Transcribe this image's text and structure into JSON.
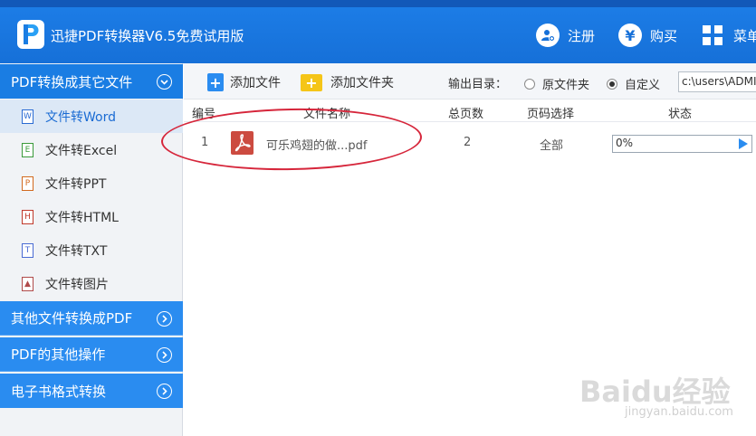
{
  "app": {
    "title": "迅捷PDF转换器V6.5免费试用版"
  },
  "topbar": {
    "register_label": "注册",
    "buy_label": "购买",
    "buy_icon_glyph": "¥",
    "menu_label": "菜单"
  },
  "sidebar": {
    "active_category": "PDF转换成其它文件",
    "sub_items": [
      {
        "label": "文件转Word",
        "icon": "word-file-icon",
        "glyph": "W",
        "active": true
      },
      {
        "label": "文件转Excel",
        "icon": "excel-file-icon",
        "glyph": "E",
        "active": false
      },
      {
        "label": "文件转PPT",
        "icon": "ppt-file-icon",
        "glyph": "P",
        "active": false
      },
      {
        "label": "文件转HTML",
        "icon": "html-file-icon",
        "glyph": "H",
        "active": false
      },
      {
        "label": "文件转TXT",
        "icon": "txt-file-icon",
        "glyph": "T",
        "active": false
      },
      {
        "label": "文件转图片",
        "icon": "image-file-icon",
        "glyph": "▲",
        "active": false
      }
    ],
    "other_categories": [
      {
        "label": "其他文件转换成PDF"
      },
      {
        "label": "PDF的其他操作"
      },
      {
        "label": "电子书格式转换"
      }
    ]
  },
  "toolbar": {
    "add_file_label": "添加文件",
    "add_folder_label": "添加文件夹",
    "output_dir_label": "输出目录：",
    "radio_original_label": "原文件夹",
    "radio_custom_label": "自定义",
    "selected_radio": "自定义",
    "output_path_value": "c:\\users\\ADMI"
  },
  "table": {
    "headers": {
      "index": "编号",
      "filename": "文件名称",
      "pages": "总页数",
      "page_select": "页码选择",
      "status": "状态"
    },
    "rows": [
      {
        "index": "1",
        "filename": "可乐鸡翅的做...pdf",
        "pages": "2",
        "page_select": "全部",
        "progress_text": "0%",
        "progress_fraction": 0
      }
    ]
  },
  "watermark": {
    "main": "Baidu经验",
    "sub": "jingyan.baidu.com"
  },
  "colors": {
    "title_bar": "#1670d8",
    "sidebar_category": "#2a8cf0",
    "highlight_ellipse": "#d6263b",
    "pdf_icon": "#cc4b40"
  }
}
